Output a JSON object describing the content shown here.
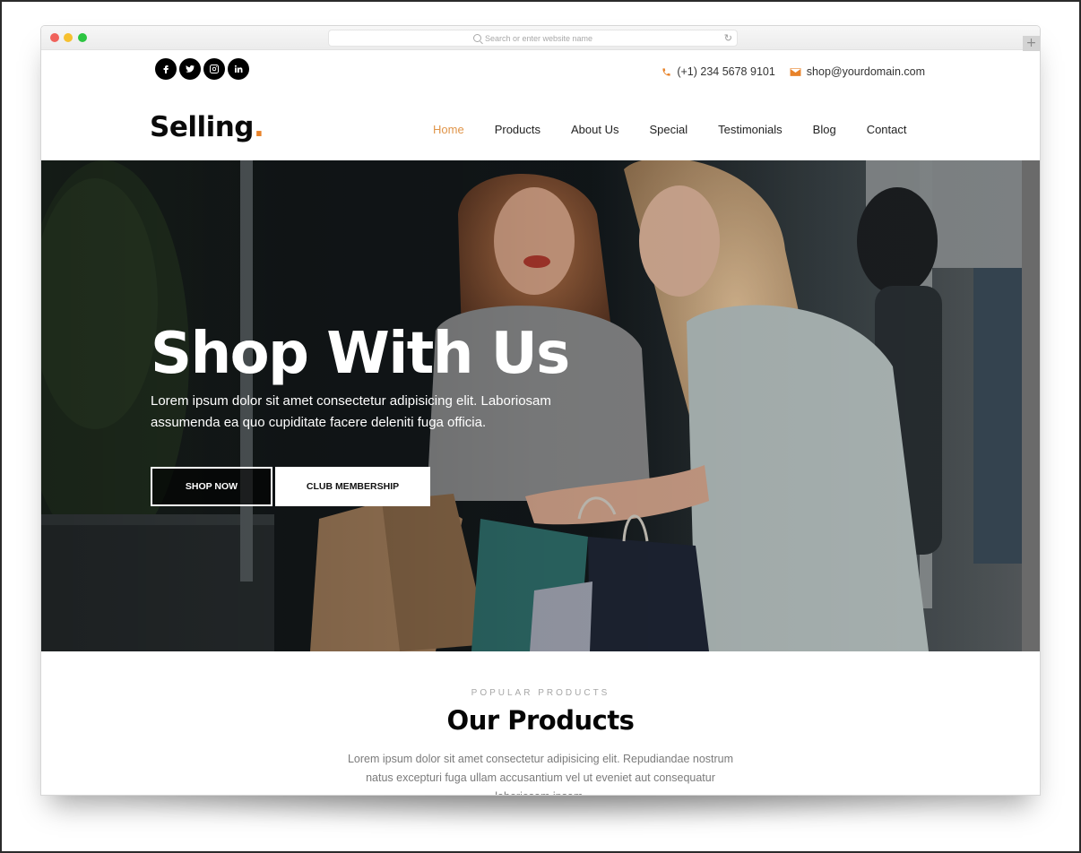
{
  "browser": {
    "address_placeholder": "Search or enter website name",
    "new_tab_label": "+",
    "reload_icon": "↻"
  },
  "topbar": {
    "social": [
      {
        "name": "facebook",
        "icon": "facebook-icon"
      },
      {
        "name": "twitter",
        "icon": "twitter-icon"
      },
      {
        "name": "instagram",
        "icon": "instagram-icon"
      },
      {
        "name": "linkedin",
        "icon": "linkedin-icon"
      }
    ],
    "phone": "(+1) 234 5678 9101",
    "email": "shop@yourdomain.com"
  },
  "header": {
    "logo_text": "Selling",
    "logo_dot": "."
  },
  "nav": {
    "items": [
      {
        "label": "Home",
        "active": true
      },
      {
        "label": "Products"
      },
      {
        "label": "About Us"
      },
      {
        "label": "Special"
      },
      {
        "label": "Testimonials"
      },
      {
        "label": "Blog"
      },
      {
        "label": "Contact"
      }
    ]
  },
  "hero": {
    "title": "Shop With Us",
    "text": "Lorem ipsum dolor sit amet consectetur adipisicing elit. Laboriosam assumenda ea quo cupiditate facere deleniti fuga officia.",
    "primary_button": "SHOP NOW",
    "secondary_button": "CLUB MEMBERSHIP"
  },
  "products": {
    "eyebrow": "POPULAR PRODUCTS",
    "title": "Our Products",
    "text": "Lorem ipsum dolor sit amet consectetur adipisicing elit. Repudiandae nostrum natus excepturi fuga ullam accusantium vel ut eveniet aut consequatur laboriosam ipsam."
  },
  "colors": {
    "accent": "#e8832a",
    "nav_active": "#e0954a",
    "text_dark": "#0a0a0a",
    "muted": "#7b7b7b"
  }
}
